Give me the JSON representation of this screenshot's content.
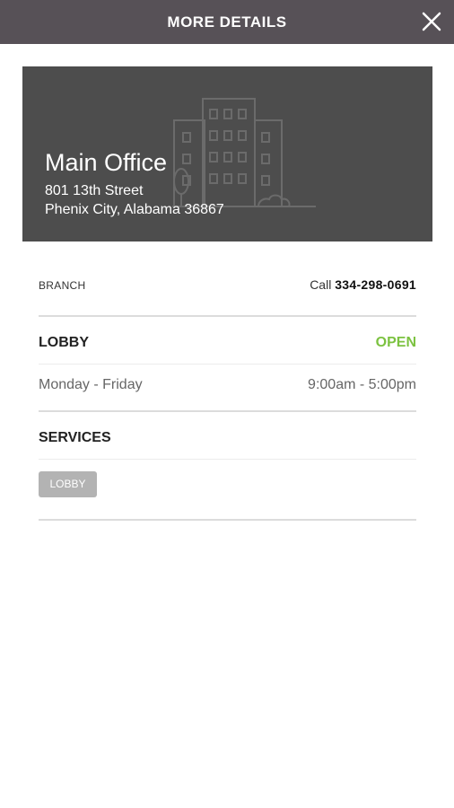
{
  "header": {
    "title": "MORE DETAILS",
    "close_icon": "close-icon"
  },
  "location": {
    "name": "Main Office",
    "address_line1": "801 13th Street",
    "address_line2": "Phenix City, Alabama 36867",
    "illustration_icon": "building-icon"
  },
  "branch": {
    "label": "BRANCH",
    "call_prefix": "Call",
    "phone": "334-298-0691"
  },
  "lobby": {
    "title": "LOBBY",
    "status": "OPEN",
    "days": "Monday - Friday",
    "hours": "9:00am - 5:00pm"
  },
  "services": {
    "title": "SERVICES",
    "tags": [
      "LOBBY"
    ]
  },
  "colors": {
    "header_bg": "#575157",
    "hero_bg": "#4d4d4d",
    "open_status": "#7cc241",
    "tag_bg": "#b3b3b3"
  }
}
